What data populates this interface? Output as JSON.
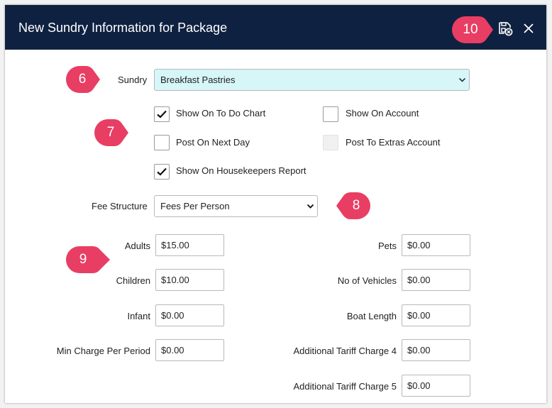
{
  "dialog": {
    "title": "New Sundry Information for Package",
    "icons": {
      "save": "save-disk-cancel-icon",
      "close": "close-icon"
    }
  },
  "callouts": {
    "c6": "6",
    "c7": "7",
    "c8": "8",
    "c9": "9",
    "c10": "10",
    "color": "#e83e63"
  },
  "sundry": {
    "label": "Sundry",
    "value": "Breakfast Pastries",
    "bg": "#d6f6f8"
  },
  "checkboxes": {
    "show_on_todo": {
      "label": "Show On To Do Chart",
      "checked": true
    },
    "show_on_account": {
      "label": "Show On Account",
      "checked": false
    },
    "post_next_day": {
      "label": "Post On Next Day",
      "checked": false
    },
    "post_extras": {
      "label": "Post To Extras Account",
      "checked": false,
      "disabled": true
    },
    "show_housekeepers": {
      "label": "Show On Housekeepers Report",
      "checked": true
    }
  },
  "fee_structure": {
    "label": "Fee Structure",
    "value": "Fees Per Person"
  },
  "fees_left": [
    {
      "label": "Adults",
      "value": "$15.00"
    },
    {
      "label": "Children",
      "value": "$10.00"
    },
    {
      "label": "Infant",
      "value": "$0.00"
    },
    {
      "label": "Min Charge Per Period",
      "value": "$0.00"
    }
  ],
  "fees_right": [
    {
      "label": "Pets",
      "value": "$0.00"
    },
    {
      "label": "No of Vehicles",
      "value": "$0.00"
    },
    {
      "label": "Boat Length",
      "value": "$0.00"
    },
    {
      "label": "Additional Tariff Charge 4",
      "value": "$0.00"
    },
    {
      "label": "Additional Tariff Charge 5",
      "value": "$0.00"
    }
  ]
}
